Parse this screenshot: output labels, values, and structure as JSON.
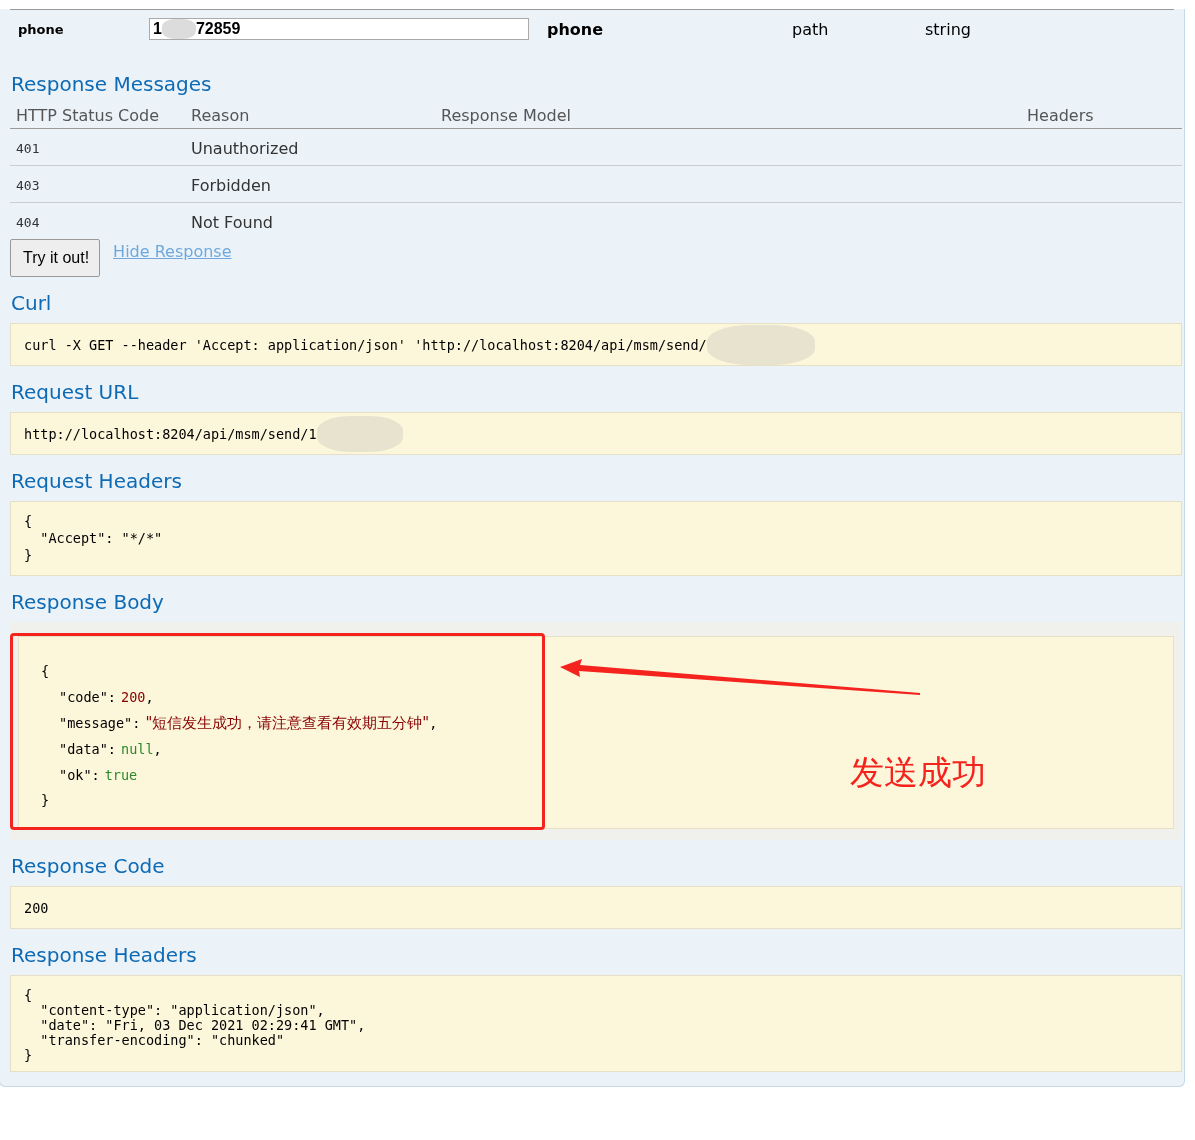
{
  "parameter": {
    "name": "phone",
    "value_start": "1",
    "value_end": "72859",
    "description": "phone",
    "param_type": "path",
    "data_type": "string"
  },
  "response_messages": {
    "title": "Response Messages",
    "columns": [
      "HTTP Status Code",
      "Reason",
      "Response Model",
      "Headers"
    ],
    "rows": [
      {
        "code": "401",
        "reason": "Unauthorized"
      },
      {
        "code": "403",
        "reason": "Forbidden"
      },
      {
        "code": "404",
        "reason": "Not Found"
      }
    ]
  },
  "try_button": "Try it out!",
  "hide_link": "Hide Response",
  "curl": {
    "title": "Curl",
    "text": "curl -X GET --header 'Accept: application/json' 'http://localhost:8204/api/msm/send/"
  },
  "request_url": {
    "title": "Request URL",
    "text": "http://localhost:8204/api/msm/send/1"
  },
  "request_headers": {
    "title": "Request Headers",
    "lines": [
      "{",
      "  \"Accept\": \"*/*\"",
      "}"
    ]
  },
  "response_body": {
    "title": "Response Body",
    "open": "{",
    "fields": [
      {
        "key": "\"code\":",
        "value": "200",
        "kind": "number",
        "suffix": ","
      },
      {
        "key": "\"message\":",
        "value": "\"短信发生成功，请注意查看有效期五分钟\"",
        "kind": "string",
        "suffix": ","
      },
      {
        "key": "\"data\":",
        "value": "null",
        "kind": "literal",
        "suffix": ","
      },
      {
        "key": "\"ok\":",
        "value": "true",
        "kind": "literal"
      }
    ],
    "close": "}"
  },
  "annotation": {
    "text": "发送成功"
  },
  "response_code": {
    "title": "Response Code",
    "text": "200"
  },
  "response_headers": {
    "title": "Response Headers",
    "lines": [
      "{",
      "  \"content-type\": \"application/json\",",
      "  \"date\": \"Fri, 03 Dec 2021 02:29:41 GMT\",",
      "  \"transfer-encoding\": \"chunked\"",
      "}"
    ]
  }
}
